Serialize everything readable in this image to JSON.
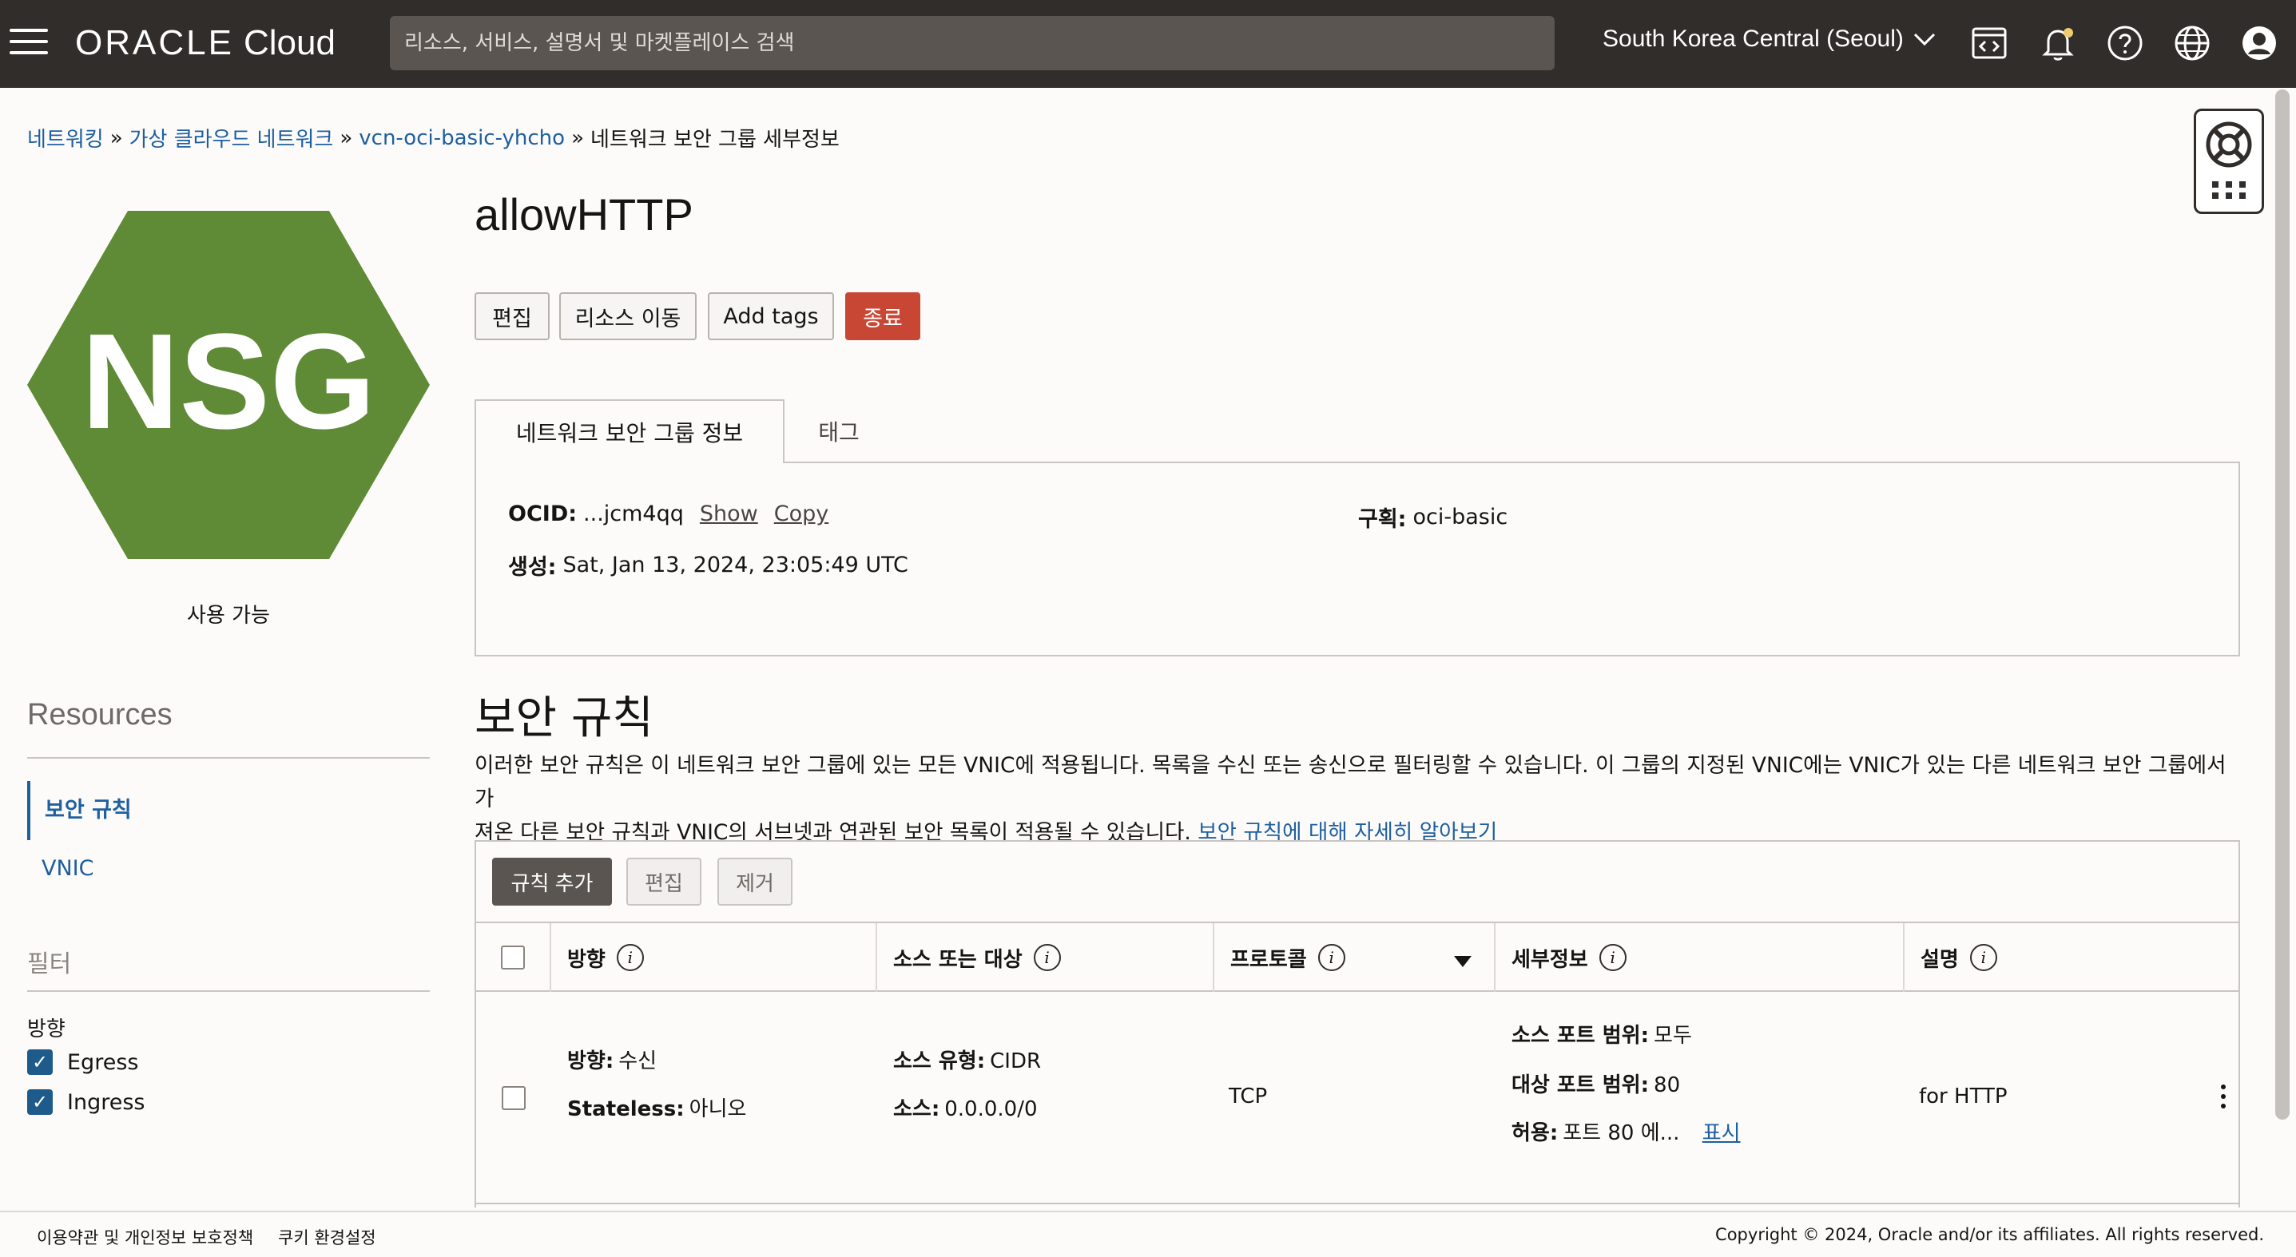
{
  "topbar": {
    "brand_oracle": "ORACLE",
    "brand_cloud": "Cloud",
    "search_placeholder": "리소스, 서비스, 설명서 및 마켓플레이스 검색",
    "region": "South Korea Central (Seoul)"
  },
  "breadcrumb": {
    "networking": "네트워킹",
    "vcn": "가상 클라우드 네트워크",
    "vcn_name": "vcn-oci-basic-yhcho",
    "current": "네트워크 보안 그룹 세부정보",
    "separator": "»"
  },
  "sidebar": {
    "badge_text": "NSG",
    "badge_color": "#5f8a36",
    "status": "사용 가능",
    "resources_title": "Resources",
    "resources": [
      {
        "label": "보안 규칙",
        "active": true
      },
      {
        "label": "VNIC",
        "active": false
      }
    ],
    "filter_title": "필터",
    "direction_label": "방향",
    "filters": [
      {
        "label": "Egress",
        "checked": true
      },
      {
        "label": "Ingress",
        "checked": true
      }
    ]
  },
  "main": {
    "title": "allowHTTP",
    "actions": {
      "edit": "편집",
      "move": "리소스 이동",
      "add_tags": "Add tags",
      "terminate": "종료"
    },
    "tabs": {
      "info": "네트워크 보안 그룹 정보",
      "tags": "태그"
    },
    "info": {
      "ocid_label": "OCID:",
      "ocid_value": "...jcm4qq",
      "show": "Show",
      "copy": "Copy",
      "compartment_label": "구획:",
      "compartment_value": "oci-basic",
      "created_label": "생성:",
      "created_value": "Sat, Jan 13, 2024, 23:05:49 UTC"
    },
    "rules_title": "보안 규칙",
    "rules_desc_1": "이러한 보안 규칙은 이 네트워크 보안 그룹에 있는 모든 VNIC에 적용됩니다. 목록을 수신 또는 송신으로 필터링할 수 있습니다. 이 그룹의 지정된 VNIC에는 VNIC가 있는 다른 네트워크 보안 그룹에서 가",
    "rules_desc_2": "져온 다른 보안 규칙과 VNIC의 서브넷과 연관된 보안 목록이 적용될 수 있습니다.",
    "rules_learn_more": "보안 규칙에 대해 자세히 알아보기",
    "rule_actions": {
      "add": "규칙 추가",
      "edit": "편집",
      "remove": "제거"
    },
    "columns": {
      "direction": "방향",
      "source_dest": "소스 또는 대상",
      "protocol": "프로토콜",
      "details": "세부정보",
      "description": "설명"
    },
    "rows": [
      {
        "direction_label": "방향:",
        "direction_value": "수신",
        "stateless_label": "Stateless:",
        "stateless_value": "아니오",
        "source_type_label": "소스 유형:",
        "source_type_value": "CIDR",
        "source_label": "소스:",
        "source_value": "0.0.0.0/0",
        "protocol": "TCP",
        "src_port_label": "소스 포트 범위:",
        "src_port_value": "모두",
        "dst_port_label": "대상 포트 범위:",
        "dst_port_value": "80",
        "allow_label": "허용:",
        "allow_value": "포트 80 에...",
        "allow_show": "표시",
        "description": "for HTTP"
      }
    ]
  },
  "footer": {
    "terms": "이용약관 및 개인정보 보호정책",
    "cookies": "쿠키 환경설정",
    "copyright": "Copyright © 2024, Oracle and/or its affiliates. All rights reserved."
  }
}
